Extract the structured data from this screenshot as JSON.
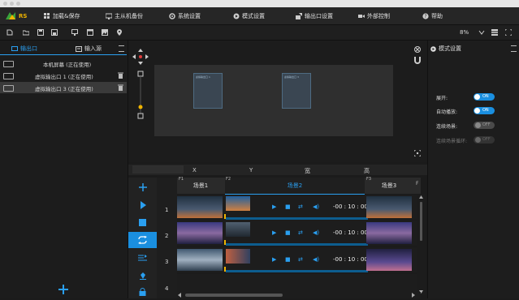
{
  "menu": {
    "brand": "RS",
    "items": [
      "加载&保存",
      "主从机备份",
      "系统设置",
      "模式设置",
      "输出口设置",
      "外部控制",
      "帮助"
    ]
  },
  "toolbar": {
    "zoom": "8%"
  },
  "left_panel": {
    "tabs": {
      "output": "输出口",
      "input": "输入源"
    },
    "outputs": [
      {
        "label": "本机屏幕 (正在使用)",
        "deletable": false,
        "selected": false
      },
      {
        "label": "虚拟输出口 1 (正在使用)",
        "deletable": true,
        "selected": false
      },
      {
        "label": "虚拟输出口 3 (正在使用)",
        "deletable": true,
        "selected": true
      }
    ]
  },
  "preview": {
    "windows": [
      {
        "label": "虚拟输出口 1"
      },
      {
        "label": "虚拟输出口 3"
      }
    ]
  },
  "xy_header": {
    "x": "X",
    "y": "Y",
    "width": "宽",
    "height": "高"
  },
  "timeline": {
    "scenes": [
      {
        "frame": "F1",
        "name": "场景1"
      },
      {
        "frame": "F2",
        "name": "场景2"
      },
      {
        "frame": "F3",
        "name": "场景3"
      }
    ],
    "extra_label": "F",
    "rows": [
      {
        "num": "1",
        "time": "-00 : 10 : 00"
      },
      {
        "num": "2",
        "time": "-00 : 10 : 00"
      },
      {
        "num": "3",
        "time": "-00 : 10 : 00"
      },
      {
        "num": "4",
        "time": ""
      }
    ]
  },
  "right_panel": {
    "title": "模式设置",
    "props": [
      {
        "label": "展开:",
        "state": "ON",
        "on": true
      },
      {
        "label": "自动播放:",
        "state": "ON",
        "on": true
      },
      {
        "label": "连续场景:",
        "state": "OFF",
        "on": false
      },
      {
        "label": "连续场景循环:",
        "state": "OFF",
        "on": false,
        "disabled": true
      }
    ]
  },
  "colors": {
    "accent": "#1a8fe0",
    "selected_row": "#3a3a3a"
  }
}
